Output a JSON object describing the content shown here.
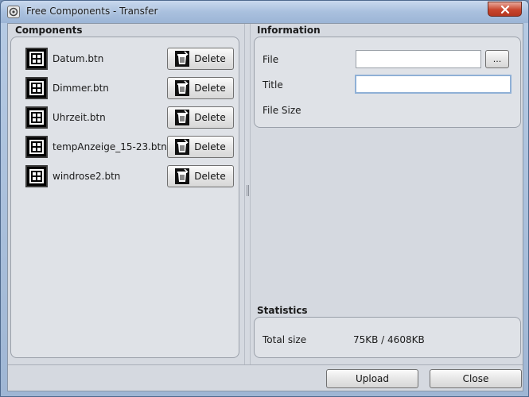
{
  "window": {
    "title": "Free Components - Transfer",
    "app_icon": "app-icon",
    "close_icon": "close-icon"
  },
  "components": {
    "heading": "Components",
    "items": [
      {
        "name": "Datum.btn",
        "delete_label": "Delete"
      },
      {
        "name": "Dimmer.btn",
        "delete_label": "Delete"
      },
      {
        "name": "Uhrzeit.btn",
        "delete_label": "Delete"
      },
      {
        "name": "tempAnzeige_15-23.btn",
        "delete_label": "Delete"
      },
      {
        "name": "windrose2.btn",
        "delete_label": "Delete"
      }
    ]
  },
  "information": {
    "heading": "Information",
    "file_label": "File",
    "file_value": "",
    "browse_label": "...",
    "title_label": "Title",
    "title_value": "",
    "filesize_label": "File Size",
    "filesize_value": ""
  },
  "statistics": {
    "heading": "Statistics",
    "total_label": "Total size",
    "total_value": "75KB / 4608KB"
  },
  "footer": {
    "upload_label": "Upload",
    "close_label": "Close"
  },
  "colors": {
    "window_frame": "#a9c0de",
    "client_bg": "#d5d9e0",
    "close_button": "#c8452d"
  }
}
